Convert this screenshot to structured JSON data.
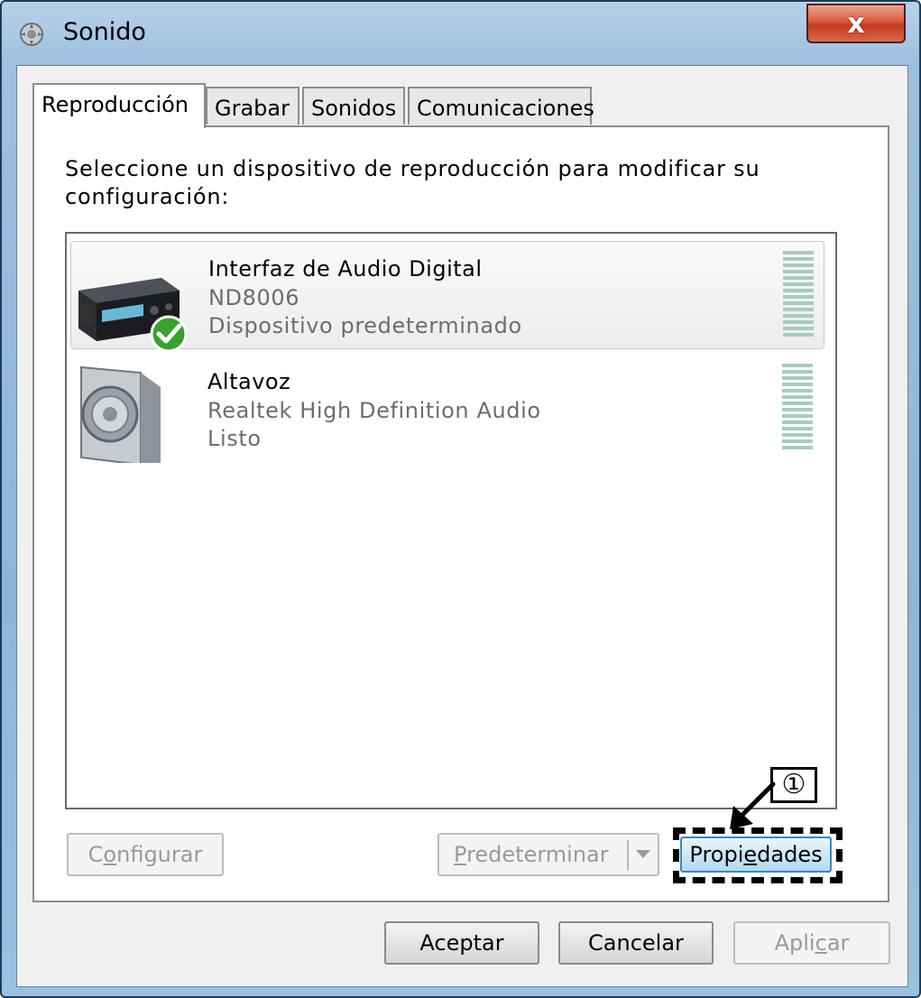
{
  "window": {
    "title": "Sonido",
    "close_glyph": "x"
  },
  "tabs": [
    {
      "label": "Reproducción",
      "active": true
    },
    {
      "label": "Grabar",
      "active": false
    },
    {
      "label": "Sonidos",
      "active": false
    },
    {
      "label": "Comunicaciones",
      "active": false
    }
  ],
  "instructions": "Seleccione un dispositivo de reproducción para modificar su configuración:",
  "devices": [
    {
      "name": "Interfaz de Audio Digital",
      "model": "ND8006",
      "status": "Dispositivo predeterminado",
      "icon": "digital-audio-interface-icon",
      "default": true
    },
    {
      "name": "Altavoz",
      "model": "Realtek High Definition Audio",
      "status": "Listo",
      "icon": "speaker-icon",
      "default": false
    }
  ],
  "buttons": {
    "configure": {
      "pre": "C",
      "mnemonic": "o",
      "post": "nfigurar"
    },
    "set_default": {
      "pre": "",
      "mnemonic": "P",
      "post": "redeterminar"
    },
    "properties": {
      "pre": "Propi",
      "mnemonic": "e",
      "post": "dades"
    },
    "ok": "Aceptar",
    "cancel": "Cancelar",
    "apply": {
      "pre": "Apli",
      "mnemonic": "c",
      "post": "ar"
    }
  },
  "callout": {
    "number": "①"
  },
  "colors": {
    "meter": "#a6ccc0",
    "close_button": "#c23a20",
    "check": "#3aa02e"
  }
}
